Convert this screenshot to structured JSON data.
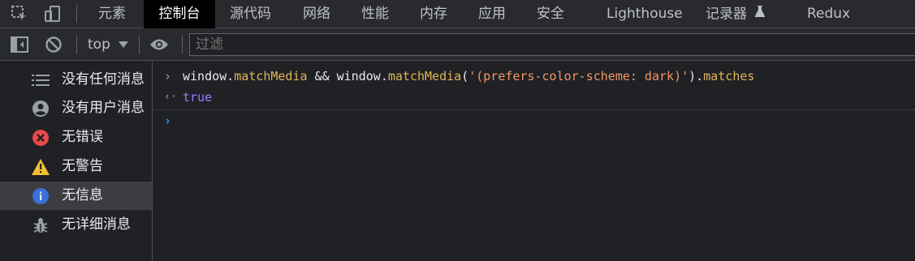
{
  "tabs": [
    {
      "label": "元素"
    },
    {
      "label": "控制台"
    },
    {
      "label": "源代码"
    },
    {
      "label": "网络"
    },
    {
      "label": "性能"
    },
    {
      "label": "内存"
    },
    {
      "label": "应用"
    },
    {
      "label": "安全"
    },
    {
      "label": "Lighthouse"
    },
    {
      "label": "记录器"
    },
    {
      "label": "Redux"
    }
  ],
  "toolbar": {
    "context": "top",
    "filter_placeholder": "过滤"
  },
  "sidebar": {
    "items": [
      {
        "label": "没有任何消息",
        "icon": "list-icon"
      },
      {
        "label": "没有用户消息",
        "icon": "user-icon"
      },
      {
        "label": "无错误",
        "icon": "error-icon"
      },
      {
        "label": "无警告",
        "icon": "warning-icon"
      },
      {
        "label": "无信息",
        "icon": "info-icon",
        "selected": true
      },
      {
        "label": "无详细消息",
        "icon": "bug-icon"
      }
    ]
  },
  "console": {
    "input": {
      "p1": "window.",
      "p2": "matchMedia",
      "p3": " && window.",
      "p4": "matchMedia",
      "p5": "(",
      "p6": "'(prefers-color-scheme: dark)'",
      "p7": ").",
      "p8": "matches"
    },
    "result": "true"
  },
  "colors": {
    "active_tab_bg": "#000000",
    "method": "#e0b55b",
    "string": "#f29766",
    "boolean": "#9980ff",
    "prompt_blue": "#4e8ff5"
  }
}
